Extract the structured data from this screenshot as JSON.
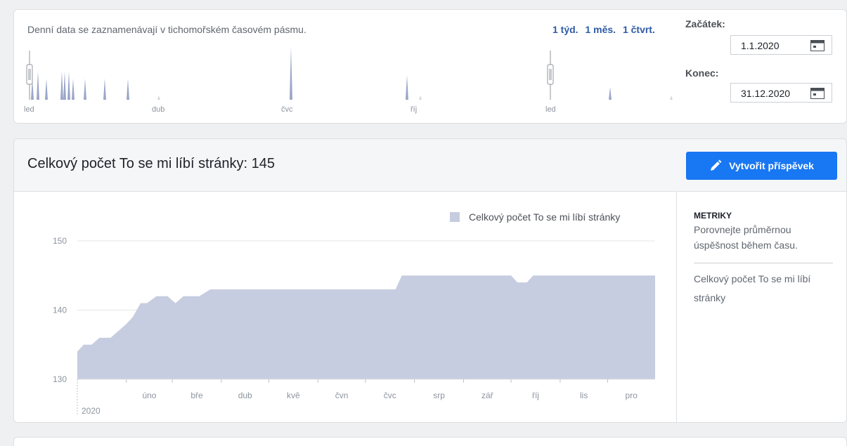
{
  "range_card": {
    "note": "Denní data se zaznamenávají v tichomořském časovém pásmu.",
    "presets": [
      "1 týd.",
      "1 měs.",
      "1 čtvrt."
    ],
    "timeline_labels": [
      "led",
      "dub",
      "čvc",
      "říj",
      "led"
    ],
    "start_label": "Začátek:",
    "start_value": "1.1.2020",
    "end_label": "Konec:",
    "end_value": "31.12.2020"
  },
  "main": {
    "title": "Celkový počet To se mi líbí stránky: 145",
    "create_button": "Vytvořit příspěvek",
    "side": {
      "heading": "METRIKY",
      "description": "Porovnejte průměrnou úspěšnost během času.",
      "item": "Celkový počet To se mi líbí stránky"
    }
  },
  "colors": {
    "accent": "#1877f2",
    "area_fill": "#c7cde0",
    "link": "#2d5ba7"
  },
  "icons": [
    "calendar-icon",
    "pencil-icon",
    "range-handle-icon"
  ],
  "chart_data": {
    "type": "area",
    "series": [
      {
        "name": "Celkový počet To se mi líbí stránky",
        "x": [
          "2020-01-01",
          "2020-01-05",
          "2020-01-10",
          "2020-01-15",
          "2020-01-22",
          "2020-02-01",
          "2020-02-05",
          "2020-02-10",
          "2020-02-14",
          "2020-02-20",
          "2020-02-27",
          "2020-03-03",
          "2020-03-08",
          "2020-03-13",
          "2020-03-18",
          "2020-03-25",
          "2020-03-30",
          "2020-04-10",
          "2020-05-01",
          "2020-06-01",
          "2020-07-01",
          "2020-07-20",
          "2020-07-24",
          "2020-08-01",
          "2020-09-01",
          "2020-10-01",
          "2020-10-05",
          "2020-10-11",
          "2020-10-15",
          "2020-11-01",
          "2020-12-01",
          "2020-12-31"
        ],
        "values": [
          134,
          135,
          135,
          136,
          136,
          138,
          139,
          141,
          141,
          142,
          142,
          141,
          142,
          142,
          142,
          143,
          143,
          143,
          143,
          143,
          143,
          143,
          145,
          145,
          145,
          145,
          144,
          144,
          145,
          145,
          145,
          145
        ]
      }
    ],
    "xlabel": "",
    "ylabel": "",
    "x_tick_labels": [
      "úno",
      "bře",
      "dub",
      "kvě",
      "čvn",
      "čvc",
      "srp",
      "zář",
      "říj",
      "lis",
      "pro"
    ],
    "x_year_label": "2020",
    "yticks": [
      130,
      140,
      150
    ],
    "ylim": [
      130,
      150
    ],
    "grid": true,
    "legend": "top-right"
  }
}
